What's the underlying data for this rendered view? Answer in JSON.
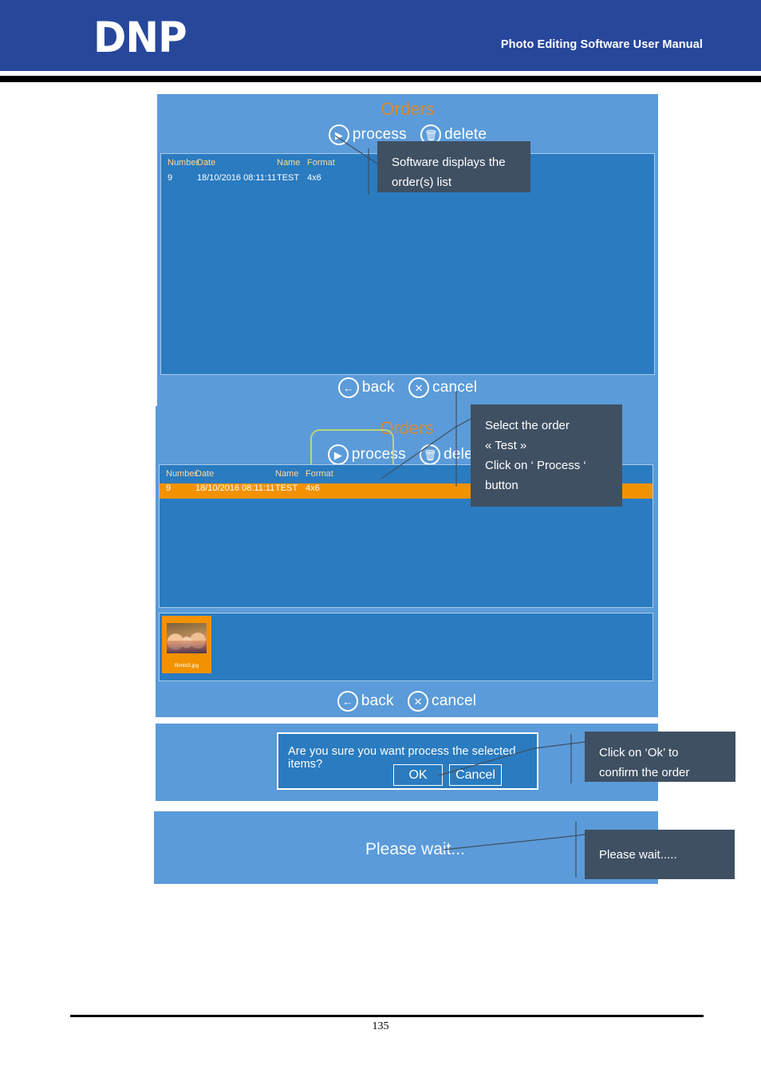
{
  "header": {
    "logo": "DNP",
    "title": "Photo Editing Software User Manual",
    "brand_color": "#27479b"
  },
  "footer": {
    "page_number": "135"
  },
  "screens": [
    {
      "id": "orders-list",
      "title": "Orders",
      "commands": [
        {
          "icon": "play-icon",
          "glyph": "▶",
          "label": "process"
        },
        {
          "icon": "trash-icon",
          "glyph": "🗑",
          "label": "delete"
        }
      ],
      "table": {
        "headers": [
          "Number",
          "Date",
          "Name",
          "Format"
        ],
        "rows": [
          {
            "number": "9",
            "date": "18/10/2016 08:11:11",
            "name": "TEST",
            "format": "4x6",
            "selected": false
          }
        ]
      },
      "nav": [
        {
          "icon": "back-arrow-icon",
          "glyph": "←",
          "label": "back"
        },
        {
          "icon": "cancel-x-icon",
          "glyph": "✕",
          "label": "cancel"
        }
      ]
    },
    {
      "id": "orders-selected",
      "title": "Orders",
      "commands": [
        {
          "icon": "play-icon",
          "glyph": "▶",
          "label": "process"
        },
        {
          "icon": "trash-icon",
          "glyph": "🗑",
          "label": "delete"
        }
      ],
      "table": {
        "headers": [
          "Number",
          "Date",
          "Name",
          "Format"
        ],
        "rows": [
          {
            "number": "9",
            "date": "18/10/2016 08:11:11",
            "name": "TEST",
            "format": "4x6",
            "selected": true
          }
        ]
      },
      "thumbnail": {
        "filename": "Bimbi3.jpg"
      },
      "nav": [
        {
          "icon": "back-arrow-icon",
          "glyph": "←",
          "label": "back"
        },
        {
          "icon": "cancel-x-icon",
          "glyph": "✕",
          "label": "cancel"
        }
      ],
      "highlight_color": "#b9d57a"
    },
    {
      "id": "confirm-dialog",
      "message": "Are you sure you want process the selected items?",
      "buttons": [
        {
          "label": "OK"
        },
        {
          "label": "Cancel"
        }
      ]
    },
    {
      "id": "please-wait",
      "message": "Please wait..."
    }
  ],
  "callouts": [
    {
      "id": "callout-order-list",
      "lines": [
        "Software displays the",
        "order(s) list"
      ]
    },
    {
      "id": "callout-select-process",
      "lines": [
        "Select the order",
        "« Test »",
        "Click on ‘ Process ‘",
        "button"
      ]
    },
    {
      "id": "callout-confirm-ok",
      "lines": [
        "Click on ‘Ok’ to",
        "confirm the order"
      ]
    },
    {
      "id": "callout-please-wait",
      "lines": [
        "Please wait....."
      ]
    }
  ],
  "colors": {
    "screen_outer": "#5b9bd9",
    "screen_list": "#2a7bc0",
    "selection": "#f39200",
    "title_accent": "#e08a28",
    "callout_bg": "#3f5063"
  }
}
